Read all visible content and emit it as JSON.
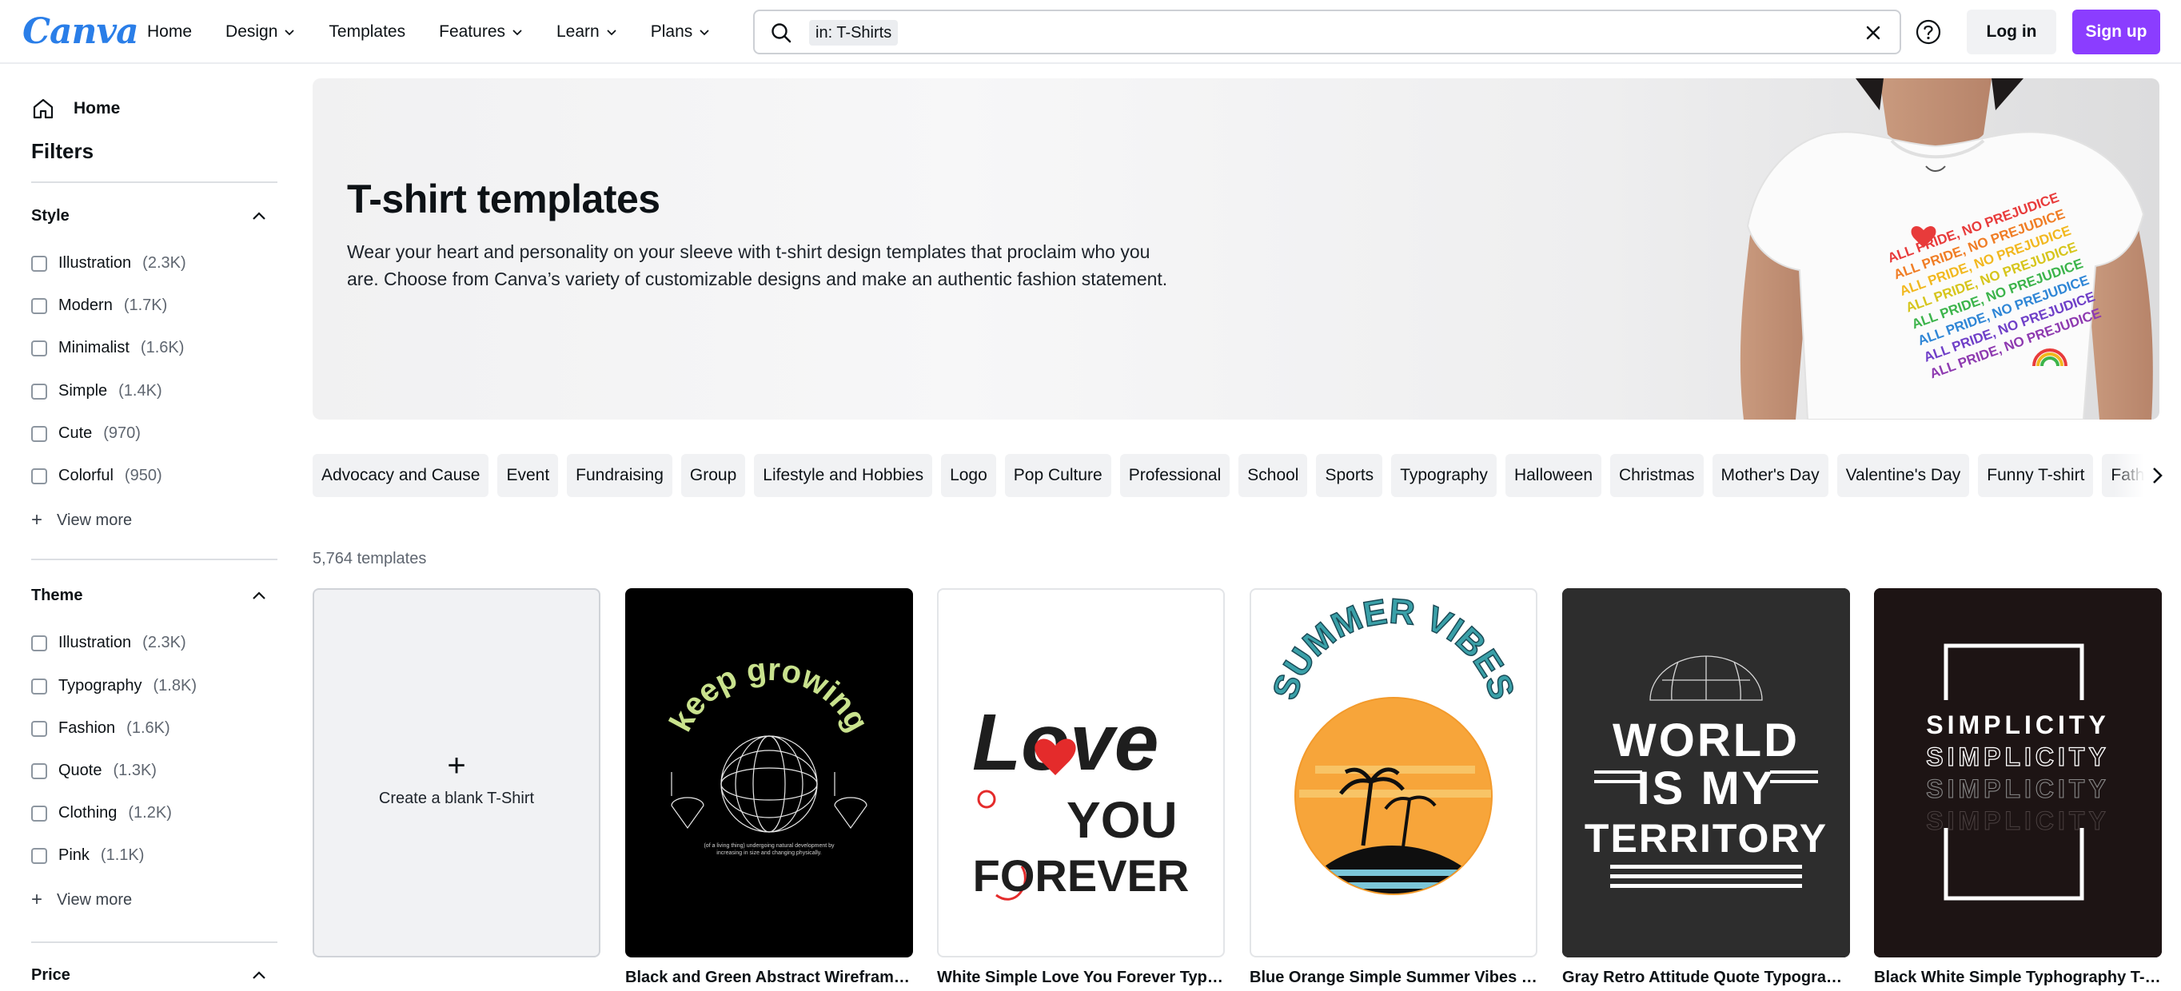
{
  "header": {
    "logo": "Canva",
    "nav": [
      {
        "label": "Home",
        "has_menu": false
      },
      {
        "label": "Design",
        "has_menu": true
      },
      {
        "label": "Templates",
        "has_menu": false
      },
      {
        "label": "Features",
        "has_menu": true
      },
      {
        "label": "Learn",
        "has_menu": true
      },
      {
        "label": "Plans",
        "has_menu": true
      }
    ],
    "search": {
      "tag": "in: T-Shirts",
      "placeholder": "",
      "value": ""
    },
    "login_label": "Log in",
    "signup_label": "Sign up",
    "accent": "#8b3dff"
  },
  "sidebar": {
    "home_label": "Home",
    "filters_title": "Filters",
    "style": {
      "title": "Style",
      "options": [
        {
          "label": "Illustration",
          "count": "(2.3K)"
        },
        {
          "label": "Modern",
          "count": "(1.7K)"
        },
        {
          "label": "Minimalist",
          "count": "(1.6K)"
        },
        {
          "label": "Simple",
          "count": "(1.4K)"
        },
        {
          "label": "Cute",
          "count": "(970)"
        },
        {
          "label": "Colorful",
          "count": "(950)"
        }
      ],
      "view_more": "View more"
    },
    "theme": {
      "title": "Theme",
      "options": [
        {
          "label": "Illustration",
          "count": "(2.3K)"
        },
        {
          "label": "Typography",
          "count": "(1.8K)"
        },
        {
          "label": "Fashion",
          "count": "(1.6K)"
        },
        {
          "label": "Quote",
          "count": "(1.3K)"
        },
        {
          "label": "Clothing",
          "count": "(1.2K)"
        },
        {
          "label": "Pink",
          "count": "(1.1K)"
        }
      ],
      "view_more": "View more"
    },
    "price": {
      "title": "Price"
    }
  },
  "hero": {
    "title": "T-shirt templates",
    "description": "Wear your heart and personality on your sleeve with t-shirt design templates that proclaim who you are. Choose from Canva’s variety of customizable designs and make an authentic fashion statement.",
    "shirt_text": "ALL PRIDE, NO PREJUDICE"
  },
  "chips": [
    "Advocacy and Cause",
    "Event",
    "Fundraising",
    "Group",
    "Lifestyle and Hobbies",
    "Logo",
    "Pop Culture",
    "Professional",
    "School",
    "Sports",
    "Typography",
    "Halloween",
    "Christmas",
    "Mother's Day",
    "Valentine's Day",
    "Funny T-shirt",
    "Father's Day T-shirt"
  ],
  "results": {
    "count_label": "5,764 templates"
  },
  "grid": {
    "blank": {
      "label": "Create a blank T-Shirt"
    },
    "cards": [
      {
        "title": "Black and Green Abstract Wireframe ...",
        "art_text": "keep growing",
        "art_small": "(of a living thing) undergoing natural development by increasing in size and changing physically."
      },
      {
        "title": "White Simple Love You Forever Typog...",
        "art_text": "Love",
        "art_text2": "YOU",
        "art_text3": "FOREVER"
      },
      {
        "title": "Blue Orange Simple Summer Vibes T-...",
        "art_text": "SUMMER VIBES"
      },
      {
        "title": "Gray Retro Attitude Quote Typograph...",
        "art_text": "WORLD",
        "art_text2": "IS MY",
        "art_text3": "TERRITORY"
      },
      {
        "title": "Black White Simple Typhography T-Sh...",
        "art_text": "SIMPLICITY"
      }
    ]
  }
}
